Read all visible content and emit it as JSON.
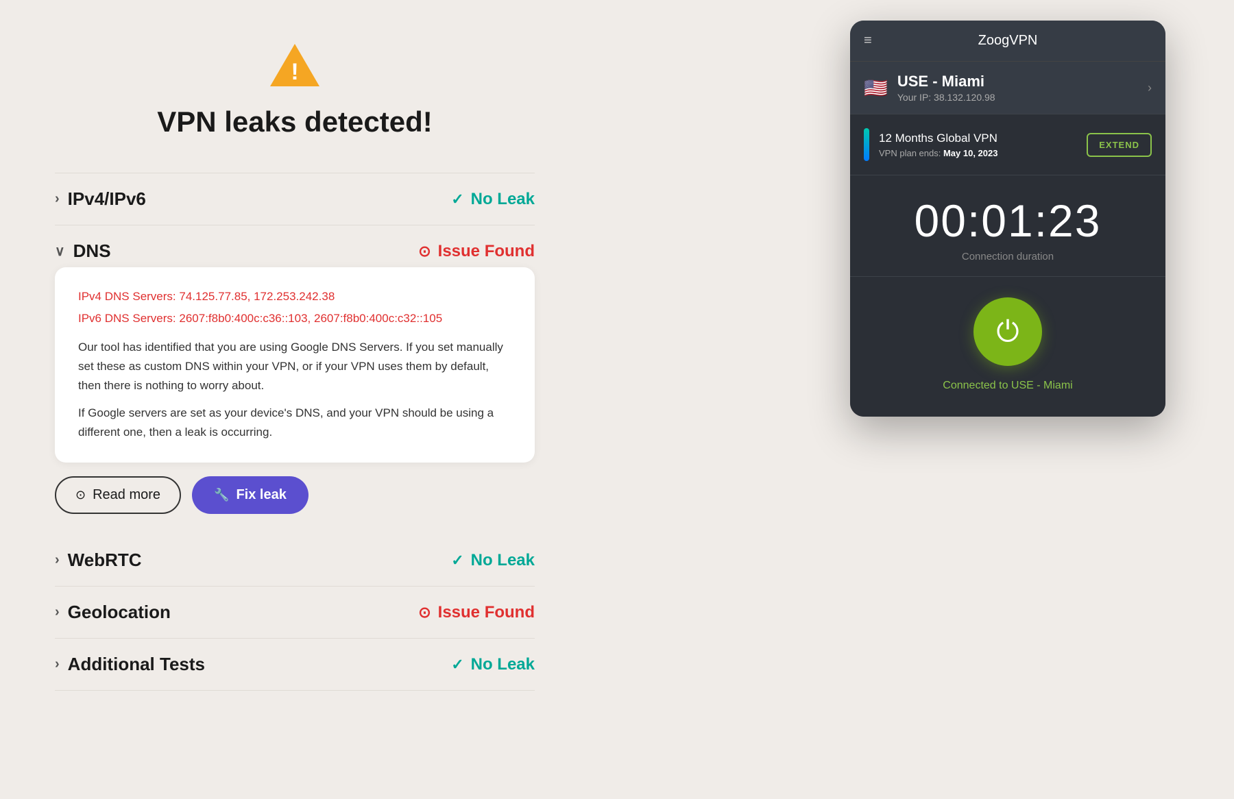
{
  "page": {
    "background": "#f0ece8"
  },
  "header": {
    "warning_icon": "⚠",
    "title": "VPN leaks detected!"
  },
  "tests": [
    {
      "id": "ipv4ipv6",
      "label": "IPv4/IPv6",
      "status": "No Leak",
      "status_type": "no_leak",
      "expanded": false
    },
    {
      "id": "dns",
      "label": "DNS",
      "status": "Issue Found",
      "status_type": "issue",
      "expanded": true
    },
    {
      "id": "webrtc",
      "label": "WebRTC",
      "status": "No Leak",
      "status_type": "no_leak",
      "expanded": false
    },
    {
      "id": "geolocation",
      "label": "Geolocation",
      "status": "Issue Found",
      "status_type": "issue",
      "expanded": false
    },
    {
      "id": "additional",
      "label": "Additional Tests",
      "status": "No Leak",
      "status_type": "no_leak",
      "expanded": false
    }
  ],
  "dns_card": {
    "ipv4_label": "IPv4 DNS Servers:",
    "ipv4_servers": "74.125.77.85, 172.253.242.38",
    "ipv6_label": "IPv6 DNS Servers:",
    "ipv6_servers": "2607:f8b0:400c:c36::103, 2607:f8b0:400c:c32::105",
    "description_1": "Our tool has identified that you are using Google DNS Servers. If you set manually set these as custom DNS within your VPN, or if your VPN uses them by default, then there is nothing to worry about.",
    "description_2": "If Google servers are set as your device's DNS, and your VPN should be using a different one, then a leak is occurring."
  },
  "buttons": {
    "read_more": "Read more",
    "fix_leak": "Fix leak"
  },
  "vpn_app": {
    "title": "ZoogVPN",
    "location": "USE - Miami",
    "ip": "Your IP: 38.132.120.98",
    "flag": "🇺🇸",
    "plan_name": "12 Months Global VPN",
    "plan_ends_label": "VPN plan ends:",
    "plan_ends_date": "May 10, 2023",
    "extend_btn": "EXTEND",
    "timer": "00:01:23",
    "timer_label": "Connection duration",
    "connected_text": "Connected to USE - Miami"
  }
}
